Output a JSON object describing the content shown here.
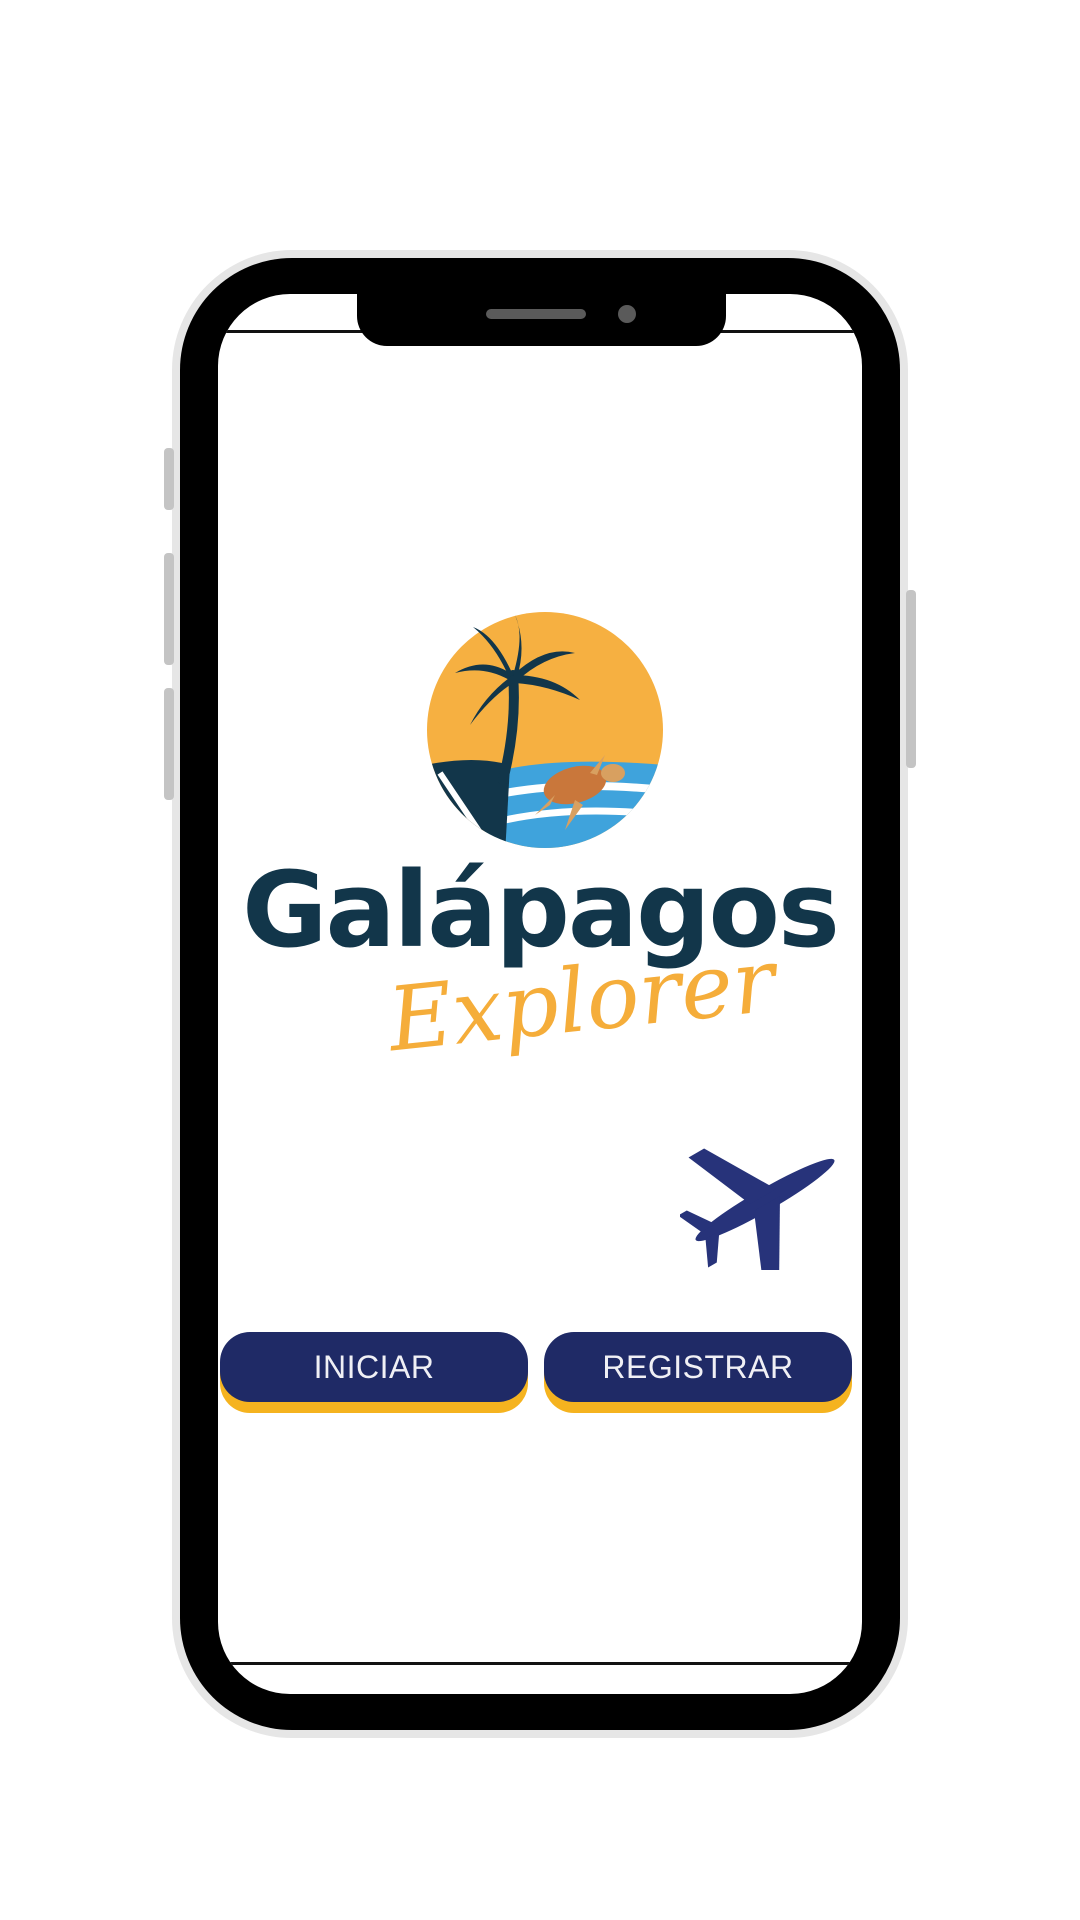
{
  "brand": {
    "title": "Galápagos",
    "subtitle": "Explorer"
  },
  "icons": {
    "logo": "palm-tree-turtle-sun-logo-icon",
    "plane": "airplane-icon"
  },
  "buttons": {
    "start_label": "INICIAR",
    "register_label": "REGISTRAR"
  },
  "colors": {
    "navy": "#1f2a66",
    "accent_yellow": "#f5b31f",
    "title_dark": "#12364a",
    "sun_orange": "#f6b041",
    "sea_blue": "#3fa3dc"
  }
}
